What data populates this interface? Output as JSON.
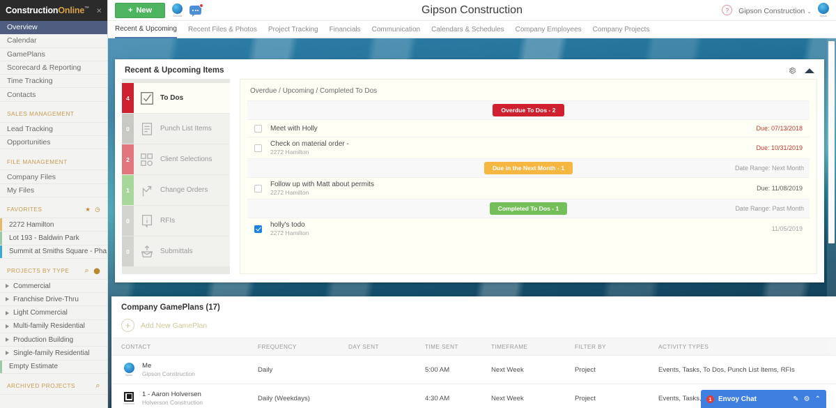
{
  "brand": {
    "part1": "Construction",
    "part2": "Online",
    "tm": "™",
    "close": "×"
  },
  "sidebar": {
    "nav": [
      {
        "label": "Overview",
        "active": true
      },
      {
        "label": "Calendar",
        "active": false
      },
      {
        "label": "GamePlans",
        "active": false
      },
      {
        "label": "Scorecard & Reporting",
        "active": false
      },
      {
        "label": "Time Tracking",
        "active": false
      },
      {
        "label": "Contacts",
        "active": false
      }
    ],
    "sales_section": "SALES MANAGEMENT",
    "sales": [
      {
        "label": "Lead Tracking"
      },
      {
        "label": "Opportunities"
      }
    ],
    "file_section": "FILE MANAGEMENT",
    "files": [
      {
        "label": "Company Files"
      },
      {
        "label": "My Files"
      }
    ],
    "favorites_section": "FAVORITES",
    "favorites": [
      {
        "label": "2272 Hamilton"
      },
      {
        "label": "Lot 193 - Baldwin Park"
      },
      {
        "label": "Summit at Smiths Square - Pha..."
      }
    ],
    "projects_section": "PROJECTS BY TYPE",
    "project_types": [
      {
        "label": "Commercial",
        "arrow": true
      },
      {
        "label": "Franchise Drive-Thru",
        "arrow": true
      },
      {
        "label": "Light Commercial",
        "arrow": true
      },
      {
        "label": "Multi-family Residential",
        "arrow": true
      },
      {
        "label": "Production Building",
        "arrow": true
      },
      {
        "label": "Single-family Residential",
        "arrow": true
      },
      {
        "label": "Empty Estimate",
        "arrow": false
      }
    ],
    "archived_section": "ARCHIVED PROJECTS"
  },
  "topbar": {
    "new_label": "New",
    "new_plus": "+",
    "globe_label": "OnCost",
    "company_title": "Gipson Construction",
    "help": "?",
    "account": "Gipson Construction",
    "chevron": "⌄",
    "avatar_label": "Gipson"
  },
  "tabs": [
    {
      "label": "Recent & Upcoming",
      "active": true
    },
    {
      "label": "Recent Files & Photos",
      "active": false
    },
    {
      "label": "Project Tracking",
      "active": false
    },
    {
      "label": "Financials",
      "active": false
    },
    {
      "label": "Communication",
      "active": false
    },
    {
      "label": "Calendars & Schedules",
      "active": false
    },
    {
      "label": "Company Employees",
      "active": false
    },
    {
      "label": "Company Projects",
      "active": false
    }
  ],
  "recent_panel": {
    "title": "Recent & Upcoming Items",
    "categories": [
      {
        "label": "To Dos",
        "count": "4",
        "color": "#cf2030",
        "icon": "checkbox-icon",
        "active": true
      },
      {
        "label": "Punch List Items",
        "count": "0",
        "color": "#c9c9c4",
        "icon": "clipboard-icon",
        "active": false
      },
      {
        "label": "Client Selections",
        "count": "2",
        "color": "#e0777f",
        "icon": "selections-icon",
        "active": false
      },
      {
        "label": "Change Orders",
        "count": "1",
        "color": "#a8d79a",
        "icon": "arrows-icon",
        "active": false
      },
      {
        "label": "RFIs",
        "count": "0",
        "color": "#d4d4cf",
        "icon": "info-doc-icon",
        "active": false
      },
      {
        "label": "Submittals",
        "count": "0",
        "color": "#d4d4cf",
        "icon": "submittal-icon",
        "active": false
      }
    ],
    "list_header": "Overdue / Upcoming / Completed To Dos",
    "rows": [
      {
        "kind": "separator",
        "pill": "Overdue To Dos - 2",
        "pill_color": "red",
        "date": ""
      },
      {
        "kind": "item",
        "checked": false,
        "title": "Meet with Holly",
        "sub": "",
        "due": "Due: 07/13/2018",
        "due_style": "overdue"
      },
      {
        "kind": "item",
        "checked": false,
        "title": "Check on material order -",
        "sub": "2272 Hamilton",
        "due": "Due: 10/31/2019",
        "due_style": "overdue"
      },
      {
        "kind": "separator",
        "pill": "Due in the Next Month - 1",
        "pill_color": "amber",
        "date": "Date Range: Next Month"
      },
      {
        "kind": "item",
        "checked": false,
        "title": "Follow up with Matt about permits",
        "sub": "2272 Hamilton",
        "due": "Due: 11/08/2019",
        "due_style": "normal"
      },
      {
        "kind": "separator",
        "pill": "Completed To Dos - 1",
        "pill_color": "green",
        "date": "Date Range: Past Month"
      },
      {
        "kind": "item",
        "checked": true,
        "title": "holly's todo",
        "sub": "2272 Hamilton",
        "due": "11/05/2019",
        "due_style": "muted"
      }
    ]
  },
  "gameplans_panel": {
    "title": "Company GamePlans (17)",
    "add_label": "Add New GamePlan",
    "add_plus": "+",
    "columns": [
      "CONTACT",
      "FREQUENCY",
      "DAY SENT",
      "TIME SENT",
      "TIMEFRAME",
      "FILTER BY",
      "ACTIVITY TYPES"
    ],
    "rows": [
      {
        "avatar": "circle-avatar",
        "avatar_caption": "Gipson",
        "name": "Me",
        "org": "Gipson Construction",
        "frequency": "Daily",
        "day_sent": "",
        "time_sent": "5:00 AM",
        "timeframe": "Next Week",
        "filter_by": "Project",
        "activity_types": "Events, Tasks, To Dos, Punch List Items, RFIs"
      },
      {
        "avatar": "square-avatar",
        "avatar_caption": "Holverson",
        "name": "1 - Aaron Holversen",
        "org": "Holverson Construction",
        "frequency": "Daily (Weekdays)",
        "day_sent": "",
        "time_sent": "4:30 AM",
        "timeframe": "Next Week",
        "filter_by": "Project",
        "activity_types": "Events, Tasks, To Dos, Punch List Items, RFIs"
      }
    ]
  },
  "envoy": {
    "count": "1",
    "title": "Envoy Chat",
    "compose": "✎",
    "gear": "⚙",
    "caret": "⌃"
  }
}
